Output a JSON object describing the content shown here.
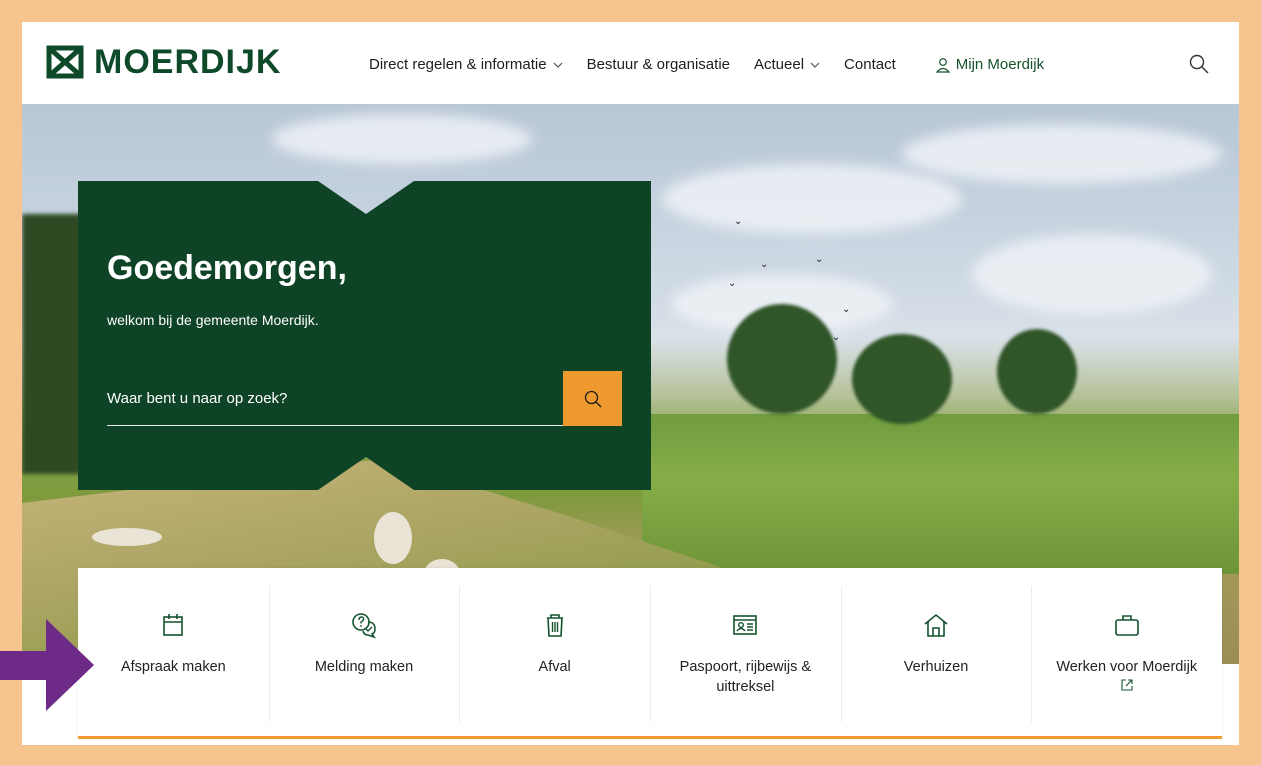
{
  "header": {
    "logo_text": "MOERDIJK",
    "nav": [
      {
        "label": "Direct regelen & informatie",
        "has_dropdown": true
      },
      {
        "label": "Bestuur & organisatie",
        "has_dropdown": false
      },
      {
        "label": "Actueel",
        "has_dropdown": true
      },
      {
        "label": "Contact",
        "has_dropdown": false
      }
    ],
    "account_label": "Mijn Moerdijk",
    "search_icon": "search-icon"
  },
  "hero": {
    "greeting": "Goedemorgen,",
    "welcome": "welkom bij de gemeente Moerdijk.",
    "search_placeholder": "Waar bent u naar op zoek?"
  },
  "quick_links": [
    {
      "label": "Afspraak maken",
      "icon": "calendar-icon"
    },
    {
      "label": "Melding maken",
      "icon": "chat-bubbles-icon"
    },
    {
      "label": "Afval",
      "icon": "trash-bin-icon"
    },
    {
      "label": "Paspoort, rijbewijs & uittreksel",
      "icon": "id-card-icon"
    },
    {
      "label": "Verhuizen",
      "icon": "house-icon"
    },
    {
      "label": "Werken voor Moerdijk",
      "icon": "briefcase-icon",
      "external": true
    }
  ],
  "colors": {
    "brand_green": "#0f4326",
    "accent_orange": "#ef9a2f",
    "frame_border": "#f6c48f",
    "annotation_arrow": "#6d2b87"
  }
}
